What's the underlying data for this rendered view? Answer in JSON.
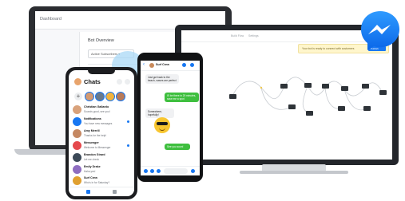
{
  "laptop": {
    "app_title": "Dashboard",
    "panel_title": "Bot Overview",
    "dropdown_label": "Active Subscribers ▾"
  },
  "monitor": {
    "tabs": [
      "Build Flow",
      "Settings"
    ],
    "banner_text": "Your bot is ready to connect with customers",
    "banner_button": "Publish"
  },
  "messenger_logo": {
    "icon": "messenger-bolt-icon",
    "color": "#1877f2"
  },
  "iphone": {
    "title": "Chats",
    "chats": [
      {
        "name": "Christian Gallardo",
        "message": "Sounds good, see you!",
        "color": "#d9a27b"
      },
      {
        "name": "Notifications",
        "message": "You have new messages",
        "color": "#1877f2"
      },
      {
        "name": "Amy Merrill",
        "message": "Thanks for the help!",
        "color": "#c58862"
      },
      {
        "name": "Messenger",
        "message": "Welcome to Messenger",
        "color": "#e5494d"
      },
      {
        "name": "Brandon Girard",
        "message": "Let me check",
        "color": "#3c4a58"
      },
      {
        "name": "Emily Drake",
        "message": "Haha yes!",
        "color": "#8e6dc1"
      },
      {
        "name": "Surf Crew",
        "message": "Who's in for Saturday?",
        "color": "#e0a030"
      }
    ]
  },
  "android": {
    "contact_name": "Surf Crew",
    "incoming": [
      "Just got back to the beach, waves are perfect",
      "Somewhere, hopefully!"
    ],
    "outgoing": [
      "I'll be there in 20 minutes, save me a spot",
      "See you soon!"
    ]
  },
  "colors": {
    "brand_blue": "#1877f2",
    "bubble_green": "#3fbf3f"
  }
}
